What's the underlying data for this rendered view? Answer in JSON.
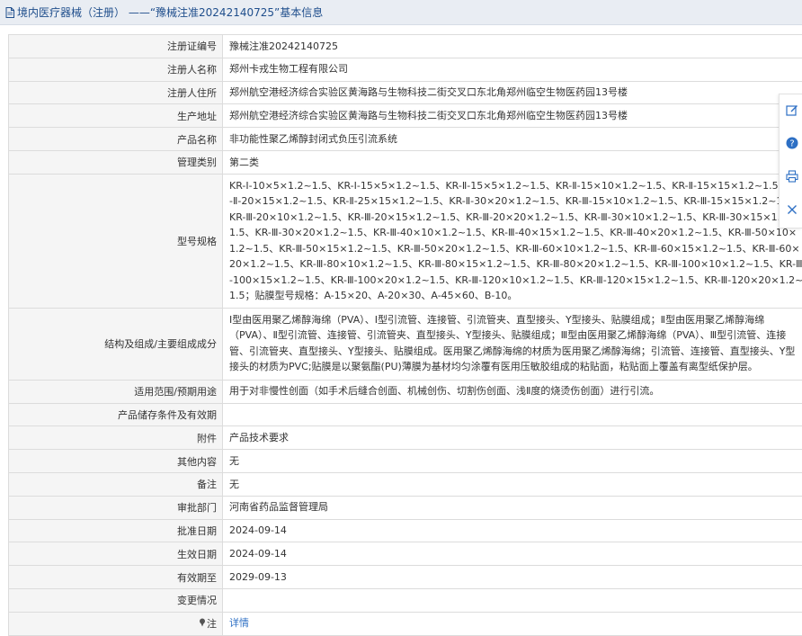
{
  "header": {
    "title": "境内医疗器械（注册） ——“豫械注准20242140725”基本信息"
  },
  "rows": [
    {
      "label": "注册证编号",
      "value": "豫械注准20242140725"
    },
    {
      "label": "注册人名称",
      "value": "郑州卡戎生物工程有限公司"
    },
    {
      "label": "注册人住所",
      "value": "郑州航空港经济综合实验区黄海路与生物科技二街交叉口东北角郑州临空生物医药园13号楼"
    },
    {
      "label": "生产地址",
      "value": "郑州航空港经济综合实验区黄海路与生物科技二街交叉口东北角郑州临空生物医药园13号楼"
    },
    {
      "label": "产品名称",
      "value": "非功能性聚乙烯醇封闭式负压引流系统"
    },
    {
      "label": "管理类别",
      "value": "第二类"
    },
    {
      "label": "型号规格",
      "value": "KR-Ⅰ-10×5×1.2~1.5、KR-Ⅰ-15×5×1.2~1.5、KR-Ⅱ-15×5×1.2~1.5、KR-Ⅱ-15×10×1.2~1.5、KR-Ⅱ-15×15×1.2~1.5、KR-Ⅱ-20×15×1.2~1.5、KR-Ⅱ-25×15×1.2~1.5、KR-Ⅱ-30×20×1.2~1.5、KR-Ⅲ-15×10×1.2~1.5、KR-Ⅲ-15×15×1.2~1.5、KR-Ⅲ-20×10×1.2~1.5、KR-Ⅲ-20×15×1.2~1.5、KR-Ⅲ-20×20×1.2~1.5、KR-Ⅲ-30×10×1.2~1.5、KR-Ⅲ-30×15×1.2~1.5、KR-Ⅲ-30×20×1.2~1.5、KR-Ⅲ-40×10×1.2~1.5、KR-Ⅲ-40×15×1.2~1.5、KR-Ⅲ-40×20×1.2~1.5、KR-Ⅲ-50×10×1.2~1.5、KR-Ⅲ-50×15×1.2~1.5、KR-Ⅲ-50×20×1.2~1.5、KR-Ⅲ-60×10×1.2~1.5、KR-Ⅲ-60×15×1.2~1.5、KR-Ⅲ-60×20×1.2~1.5、KR-Ⅲ-80×10×1.2~1.5、KR-Ⅲ-80×15×1.2~1.5、KR-Ⅲ-80×20×1.2~1.5、KR-Ⅲ-100×10×1.2~1.5、KR-Ⅲ-100×15×1.2~1.5、KR-Ⅲ-100×20×1.2~1.5、KR-Ⅲ-120×10×1.2~1.5、KR-Ⅲ-120×15×1.2~1.5、KR-Ⅲ-120×20×1.2~1.5；贴膜型号规格：A-15×20、A-20×30、A-45×60、B-10。"
    },
    {
      "label": "结构及组成/主要组成成分",
      "value": "Ⅰ型由医用聚乙烯醇海绵（PVA）、Ⅰ型引流管、连接管、引流管夹、直型接头、Y型接头、贴膜组成；Ⅱ型由医用聚乙烯醇海绵（PVA）、Ⅱ型引流管、连接管、引流管夹、直型接头、Y型接头、贴膜组成；Ⅲ型由医用聚乙烯醇海绵（PVA）、Ⅲ型引流管、连接管、引流管夹、直型接头、Y型接头、贴膜组成。医用聚乙烯醇海绵的材质为医用聚乙烯醇海绵；引流管、连接管、直型接头、Y型接头的材质为PVC;贴膜是以聚氨酯(PU)薄膜为基材均匀涂覆有医用压敏胶组成的粘贴面，粘贴面上覆盖有离型纸保护层。"
    },
    {
      "label": "适用范围/预期用途",
      "value": "用于对非慢性创面（如手术后缝合创面、机械创伤、切割伤创面、浅Ⅱ度的烧烫伤创面）进行引流。"
    },
    {
      "label": "产品储存条件及有效期",
      "value": ""
    },
    {
      "label": "附件",
      "value": "产品技术要求"
    },
    {
      "label": "其他内容",
      "value": "无"
    },
    {
      "label": "备注",
      "value": "无"
    },
    {
      "label": "审批部门",
      "value": "河南省药品监督管理局"
    },
    {
      "label": "批准日期",
      "value": "2024-09-14"
    },
    {
      "label": "生效日期",
      "value": "2024-09-14"
    },
    {
      "label": "有效期至",
      "value": "2029-09-13"
    },
    {
      "label": "变更情况",
      "value": ""
    }
  ],
  "note_row": {
    "label": "注",
    "link_text": "详情"
  },
  "side_tools": [
    "edit-icon",
    "help-icon",
    "print-icon",
    "close-icon"
  ],
  "colors": {
    "header_bg": "#e9edf3",
    "title": "#1f4e8c",
    "link": "#2d6fc4",
    "label_bg": "#f5f5f5",
    "border": "#dcdcdc"
  }
}
